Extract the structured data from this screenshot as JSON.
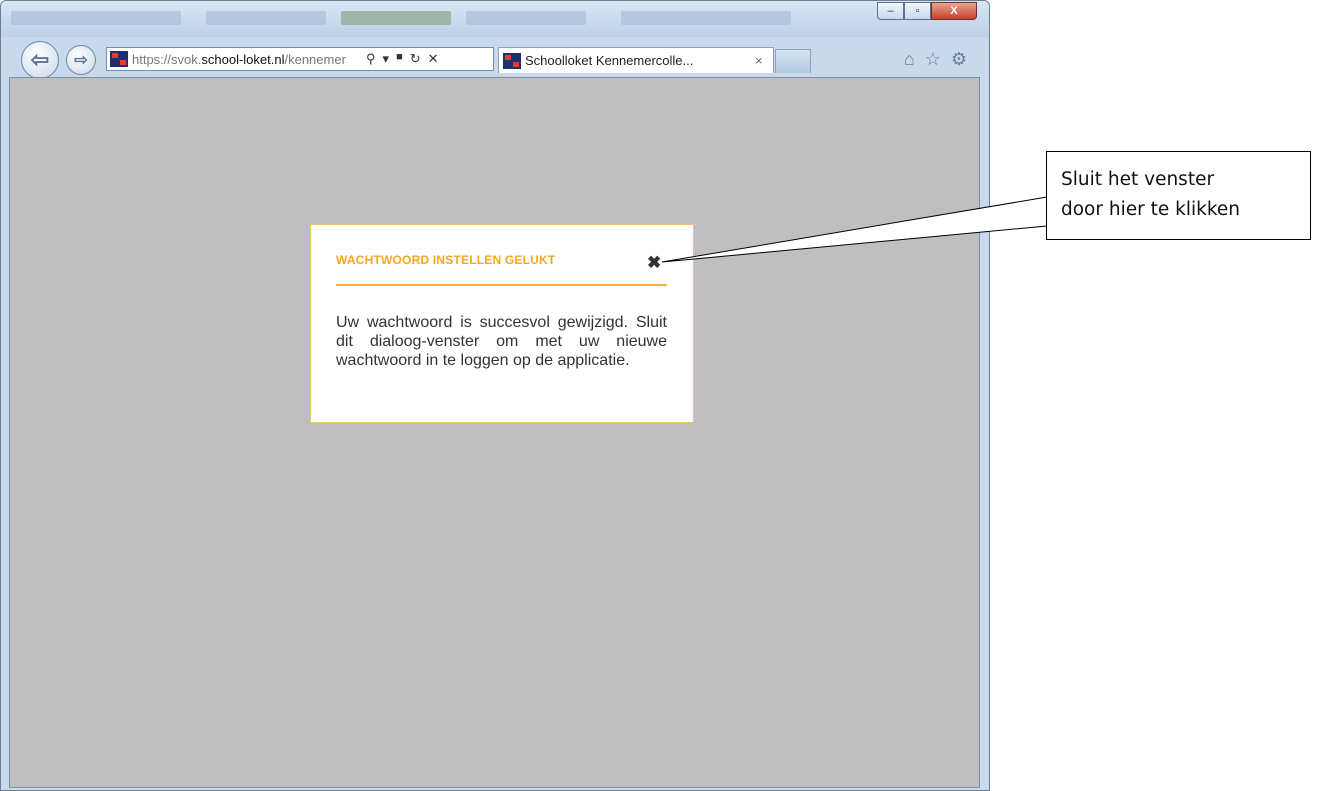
{
  "browser": {
    "url": {
      "scheme": "https://",
      "prefix": "svok.",
      "domain": "school-loket.nl",
      "path": "/kennemer"
    },
    "tab": {
      "title": "Schoolloket Kennemercolle...",
      "close_icon": "×"
    },
    "window_buttons": {
      "minimize": "–",
      "maximize": "▫",
      "close": "X"
    },
    "tools": {
      "home": "⌂",
      "favorites": "☆",
      "settings": "⚙"
    },
    "address_icons": {
      "search": "⚲",
      "dropdown": "▾",
      "lock": "🔒",
      "refresh": "↻",
      "stop": "✕"
    }
  },
  "dialog": {
    "title": "WACHTWOORD INSTELLEN GELUKT",
    "close_icon": "✖",
    "body": "Uw wachtwoord is succesvol gewijzigd. Sluit dit dialoog-venster om met uw nieuwe wachtwoord in te loggen op de applicatie."
  },
  "callout": {
    "line1": "Sluit het venster",
    "line2": "door hier te klikken"
  },
  "colors": {
    "accent": "#f5a623",
    "overlay": "#bfbfbf"
  }
}
